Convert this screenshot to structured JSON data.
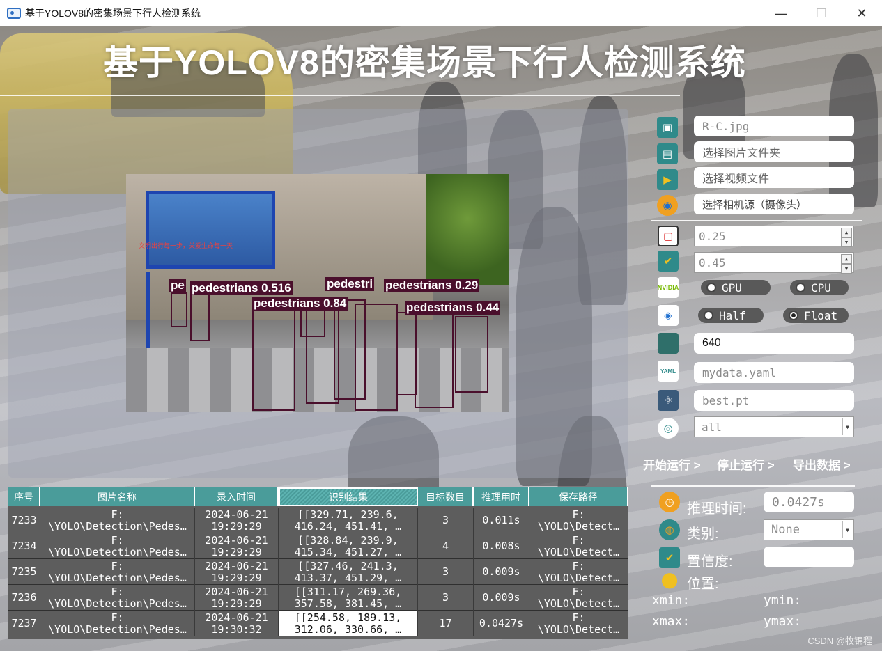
{
  "window": {
    "title": "基于YOLOV8的密集场景下行人检测系统",
    "controls": {
      "minimize": "—",
      "maximize": "☐",
      "close": "✕"
    }
  },
  "header": {
    "title": "基于YOLOV8的密集场景下行人检测系统"
  },
  "detection_image": {
    "screen_text": "文明出行每一步，关爱生命每一天",
    "labels": [
      "pedestrians 0.516",
      "pedestri",
      "pedestrians 0.29",
      "pedestrians 0.84",
      "pedestrians 0.44",
      "pe"
    ],
    "box_color": "#4a0f2c"
  },
  "controls": {
    "image_file": "R-C.jpg",
    "image_folder_placeholder": "选择图片文件夹",
    "video_placeholder": "选择视频文件",
    "camera_placeholder": "选择相机源（摄像头）",
    "confidence": "0.25",
    "iou": "0.45",
    "device_options": [
      "GPU",
      "CPU"
    ],
    "device_selected": "CPU",
    "precision_options": [
      "Half",
      "Float"
    ],
    "precision_selected": "Float",
    "img_size": "640",
    "data_yaml": "mydata.yaml",
    "weights": "best.pt",
    "class_filter": "all",
    "run": "开始运行 >",
    "stop": "停止运行 >",
    "export": "导出数据 >"
  },
  "info": {
    "infer_time_label": "推理时间:",
    "infer_time_value": "0.0427s",
    "class_label": "类别:",
    "class_value": "None",
    "conf_label": "置信度:",
    "conf_value": "",
    "pos_label": "位置:",
    "xmin": "xmin:",
    "ymin": "ymin:",
    "xmax": "xmax:",
    "ymax": "ymax:"
  },
  "table": {
    "headers": [
      "序号",
      "图片名称",
      "录入时间",
      "识别结果",
      "目标数目",
      "推理用时",
      "保存路径"
    ],
    "sorted_column": 3,
    "rows": [
      [
        "7233",
        "F:\n\\YOLO\\Detection\\Pedes…",
        "2024-06-21\n19:29:29",
        "[[329.71, 239.6,\n416.24, 451.41, …",
        "3",
        "0.011s",
        "F:\n\\YOLO\\Detect…"
      ],
      [
        "7234",
        "F:\n\\YOLO\\Detection\\Pedes…",
        "2024-06-21\n19:29:29",
        "[[328.84, 239.9,\n415.34, 451.27, …",
        "4",
        "0.008s",
        "F:\n\\YOLO\\Detect…"
      ],
      [
        "7235",
        "F:\n\\YOLO\\Detection\\Pedes…",
        "2024-06-21\n19:29:29",
        "[[327.46, 241.3,\n413.37, 451.29, …",
        "3",
        "0.009s",
        "F:\n\\YOLO\\Detect…"
      ],
      [
        "7236",
        "F:\n\\YOLO\\Detection\\Pedes…",
        "2024-06-21\n19:29:29",
        "[[311.17, 269.36,\n357.58, 381.45, …",
        "3",
        "0.009s",
        "F:\n\\YOLO\\Detect…"
      ],
      [
        "7237",
        "F:\n\\YOLO\\Detection\\Pedes…",
        "2024-06-21\n19:30:32",
        "[[254.58, 189.13,\n312.06, 330.66, …",
        "17",
        "0.0427s",
        "F:\n\\YOLO\\Detect…"
      ]
    ],
    "selected_row": 4,
    "selected_col": 3
  },
  "watermark": "CSDN @牧锦程",
  "colors": {
    "header_teal": "#4a9c9a",
    "table_bg": "#5d5d5d",
    "box": "#4a0f2c",
    "pill": "#595959"
  }
}
